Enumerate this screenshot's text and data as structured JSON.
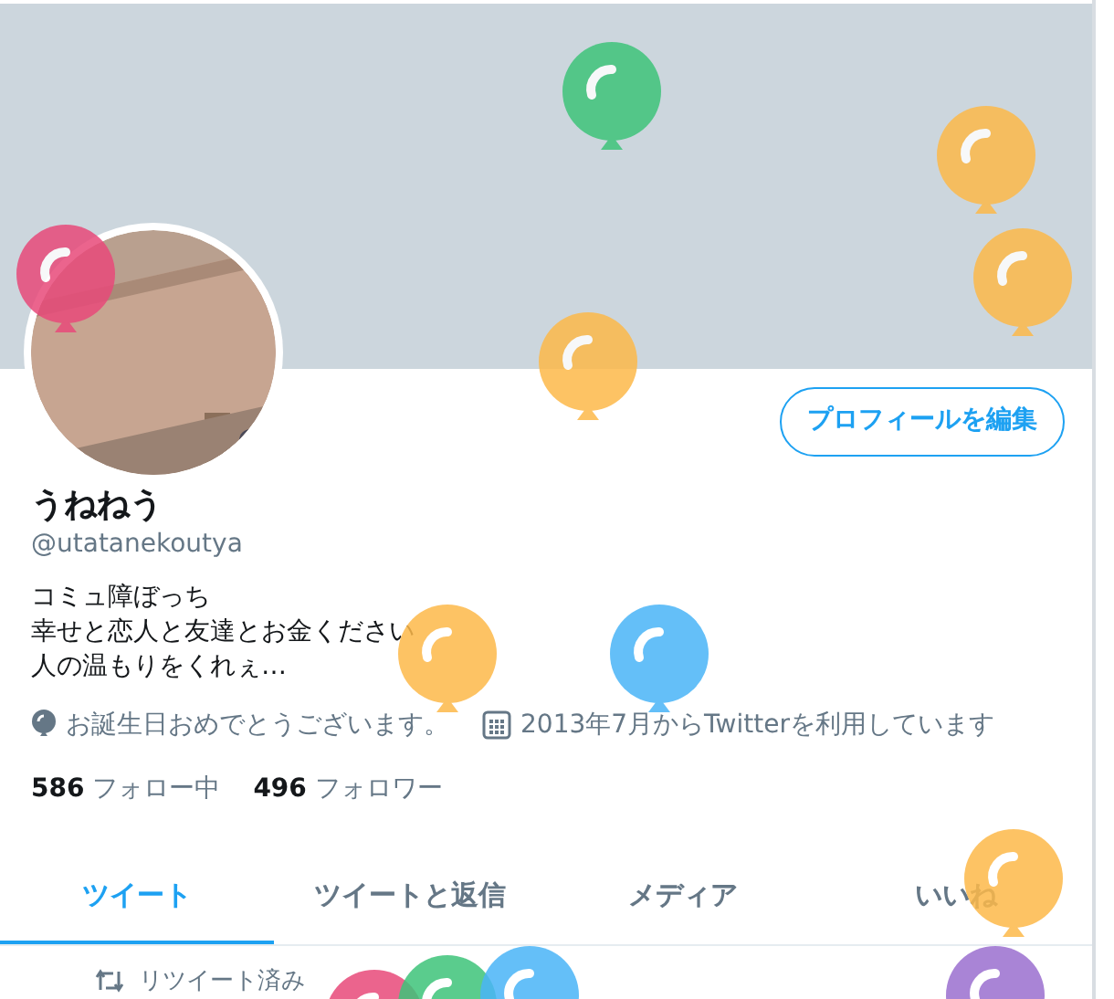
{
  "profile": {
    "name": "うねねう",
    "handle": "@utatanekoutya",
    "edit_button": "プロフィールを編集",
    "bio_lines": [
      "コミュ障ぼっち",
      "幸せと恋人と友達とお金ください",
      "人の温もりをくれぇ…"
    ],
    "meta": [
      {
        "kind": "birthday",
        "text": "お誕生日おめでとうございます。"
      },
      {
        "kind": "joined",
        "text": "2013年7月からTwitterを利用しています"
      }
    ],
    "stats": [
      {
        "count": "586",
        "label": "フォロー中"
      },
      {
        "count": "496",
        "label": "フォロワー"
      }
    ]
  },
  "tabs": [
    {
      "label": "ツイート",
      "selected": true
    },
    {
      "label": "ツイートと返信",
      "selected": false
    },
    {
      "label": "メディア",
      "selected": false
    },
    {
      "label": "いいね",
      "selected": false
    }
  ],
  "retweet_note": "リツイート済み"
}
